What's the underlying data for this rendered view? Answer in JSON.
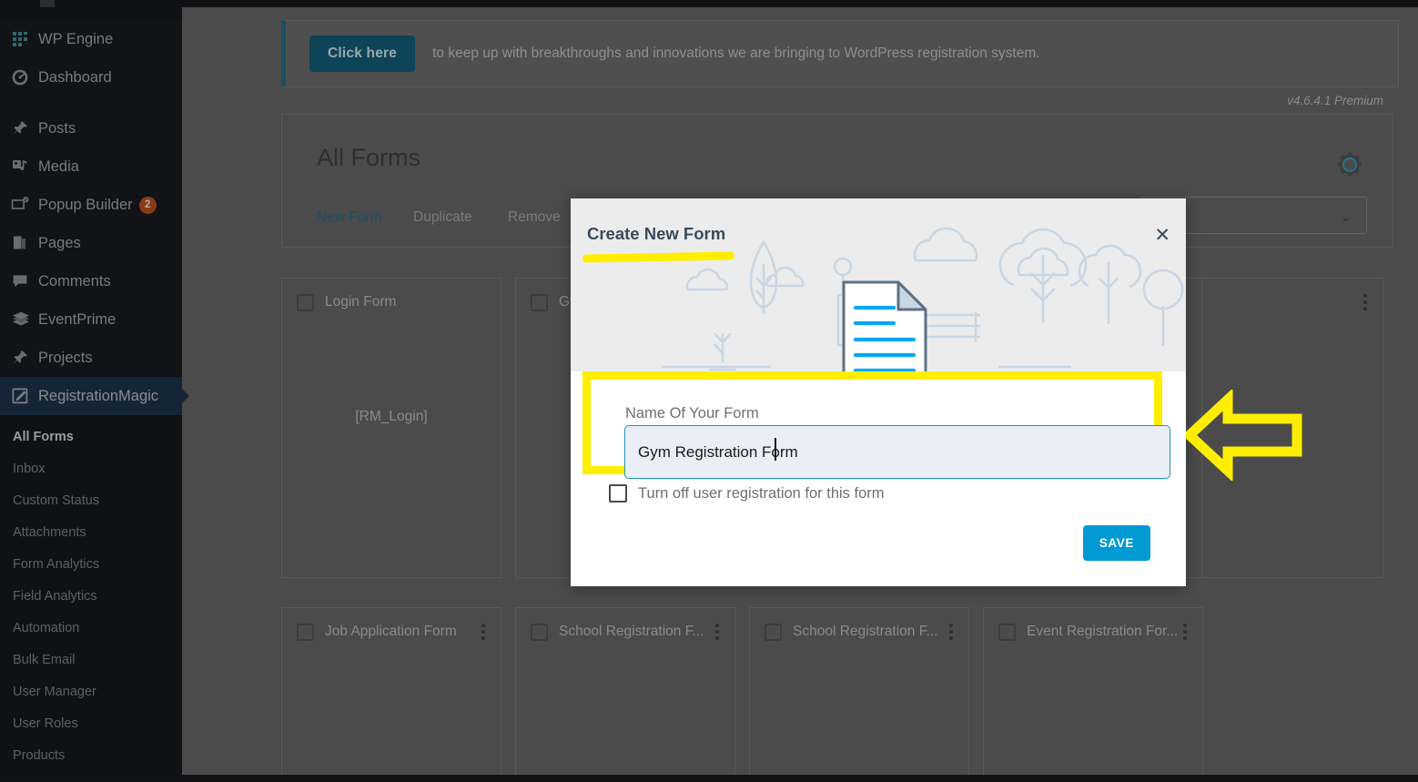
{
  "sidebar": {
    "items": [
      {
        "label": "WP Engine",
        "icon": "wp-engine-icon",
        "badge": null
      },
      {
        "label": "Dashboard",
        "icon": "dashboard-icon",
        "badge": null
      },
      {
        "label": "Posts",
        "icon": "pin-icon",
        "badge": null
      },
      {
        "label": "Media",
        "icon": "media-icon",
        "badge": null
      },
      {
        "label": "Popup Builder",
        "icon": "popup-icon",
        "badge": "2"
      },
      {
        "label": "Pages",
        "icon": "pages-icon",
        "badge": null
      },
      {
        "label": "Comments",
        "icon": "comment-icon",
        "badge": null
      },
      {
        "label": "EventPrime",
        "icon": "eventprime-icon",
        "badge": null
      },
      {
        "label": "Projects",
        "icon": "pin-icon",
        "badge": null
      },
      {
        "label": "RegistrationMagic",
        "icon": "registrationmagic-icon",
        "badge": null
      }
    ],
    "active_item": "RegistrationMagic",
    "submenu": [
      {
        "label": "All Forms",
        "current": true
      },
      {
        "label": "Inbox",
        "current": false
      },
      {
        "label": "Custom Status",
        "current": false
      },
      {
        "label": "Attachments",
        "current": false
      },
      {
        "label": "Form Analytics",
        "current": false
      },
      {
        "label": "Field Analytics",
        "current": false
      },
      {
        "label": "Automation",
        "current": false
      },
      {
        "label": "Bulk Email",
        "current": false
      },
      {
        "label": "User Manager",
        "current": false
      },
      {
        "label": "User Roles",
        "current": false
      },
      {
        "label": "Products",
        "current": false
      }
    ]
  },
  "notice": {
    "button_label": "Click here",
    "text": "to keep up with breakthroughs and innovations we are bringing to WordPress registration system."
  },
  "version_label": "v4.6.4.1 Premium",
  "forms_panel": {
    "title": "All Forms",
    "links": [
      {
        "label": "New Form",
        "primary": true
      },
      {
        "label": "Duplicate",
        "primary": false
      },
      {
        "label": "Remove",
        "primary": false
      }
    ],
    "gear_icon": "gear-icon",
    "select_value": "",
    "select_chevron": "chevron-down-icon"
  },
  "cards_row1": [
    {
      "title": "Login Form",
      "shortcode": "[RM_Login]"
    },
    {
      "title": "Gym",
      "shortcode": "["
    }
  ],
  "cards_row2": [
    {
      "title": "Job Application Form",
      "shortcode": ""
    },
    {
      "title": "School Registration F...",
      "shortcode": ""
    },
    {
      "title": "School Registration F...",
      "shortcode": ""
    },
    {
      "title": "Event Registration For...",
      "shortcode": ""
    }
  ],
  "modal": {
    "title": "Create New Form",
    "close_icon": "close-icon",
    "field_label": "Name Of Your Form",
    "input_value": "Gym Registration Form",
    "input_placeholder": "Name Of Your Form",
    "checkbox_label": "Turn off user registration for this form",
    "checkbox_checked": false,
    "save_label": "SAVE"
  },
  "annotations": {
    "arrow": "left-arrow-annotation",
    "highlight_color": "#ffee00",
    "accent_color": "#0099d4",
    "input_border_color": "#2196b5"
  }
}
